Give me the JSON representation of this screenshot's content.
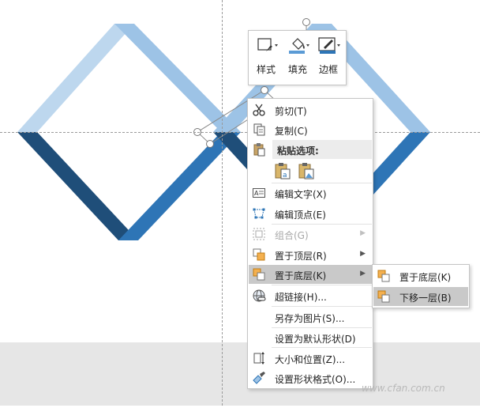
{
  "mini_toolbar": {
    "buttons": [
      {
        "label": "样式",
        "icon": "style-icon"
      },
      {
        "label": "填充",
        "icon": "fill-bucket-icon"
      },
      {
        "label": "边框",
        "icon": "outline-pen-icon"
      }
    ]
  },
  "context_menu": {
    "items": [
      {
        "label": "剪切(T)",
        "icon": "scissors-icon"
      },
      {
        "label": "复制(C)",
        "icon": "copy-icon"
      },
      {
        "label": "粘贴选项:",
        "icon": "paste-icon"
      },
      {
        "label": "编辑文字(X)",
        "icon": "edit-text-icon"
      },
      {
        "label": "编辑顶点(E)",
        "icon": "edit-points-icon"
      },
      {
        "label": "组合(G)",
        "icon": "group-icon",
        "disabled": true
      },
      {
        "label": "置于顶层(R)",
        "icon": "bring-to-front-icon"
      },
      {
        "label": "置于底层(K)",
        "icon": "send-to-back-icon"
      },
      {
        "label": "超链接(H)...",
        "icon": "hyperlink-icon"
      },
      {
        "label": "另存为图片(S)..."
      },
      {
        "label": "设置为默认形状(D)"
      },
      {
        "label": "大小和位置(Z)...",
        "icon": "size-position-icon"
      },
      {
        "label": "设置形状格式(O)...",
        "icon": "format-shape-icon"
      }
    ],
    "paste_options": [
      "keep-text-only-icon",
      "paste-as-picture-icon"
    ]
  },
  "submenu": {
    "items": [
      {
        "label": "置于底层(K)",
        "icon": "send-to-back-icon"
      },
      {
        "label": "下移一层(B)",
        "icon": "send-backward-icon"
      }
    ]
  },
  "watermark": "www.cfan.com.cn",
  "colors": {
    "light_blue": "#bdd7ee",
    "mid_blue": "#9dc3e6",
    "blue": "#2e75b6",
    "dark_blue": "#1f4e79",
    "menu_highlight": "#c9c9c9"
  }
}
